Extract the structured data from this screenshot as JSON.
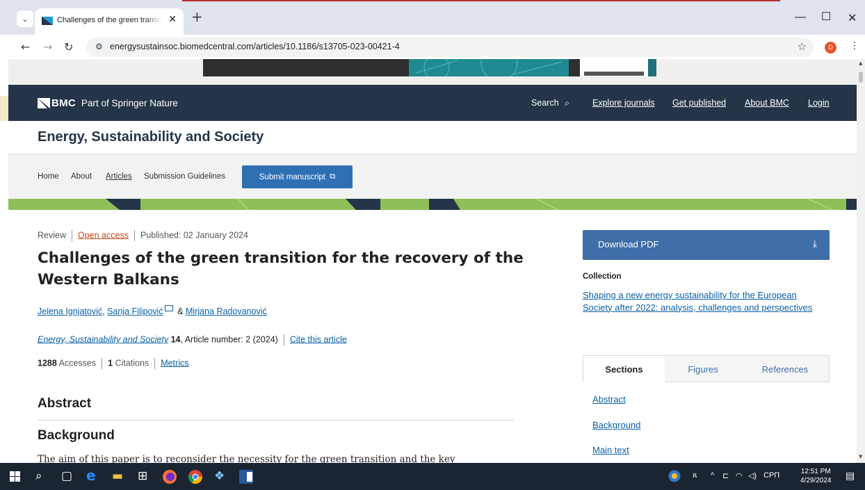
{
  "browser": {
    "tab_title": "Challenges of the green transiti",
    "url": "energysustainsoc.biomedcentral.com/articles/10.1186/s13705-023-00421-4",
    "profile_initial": "D"
  },
  "bmc_header": {
    "logo_text": "BMC",
    "part_of": "Part of Springer Nature",
    "search_label": "Search",
    "links": [
      "Explore journals",
      "Get published",
      "About BMC",
      "Login"
    ]
  },
  "journal": {
    "title": "Energy, Sustainability and Society",
    "nav": [
      "Home",
      "About",
      "Articles",
      "Submission Guidelines"
    ],
    "submit_label": "Submit manuscript"
  },
  "article": {
    "type": "Review",
    "open_access": "Open access",
    "published": "Published: 02 January 2024",
    "title": "Challenges of the green transition for the recovery of the Western Balkans",
    "authors": [
      "Jelena Ignjatović",
      "Sanja Filipović",
      "Mirjana Radovanović"
    ],
    "author_sep_1": ",",
    "author_sep_2": "&",
    "journal_name": "Energy, Sustainability and Society",
    "volume": "14",
    "article_number": ", Article number: 2 (2024)",
    "cite_label": "Cite this article",
    "accesses_count": "1288",
    "accesses_label": "Accesses",
    "citations_count": "1",
    "citations_label": "Citations",
    "metrics_label": "Metrics",
    "abstract_heading": "Abstract",
    "background_heading": "Background",
    "body_first_line": "The aim of this paper is to reconsider the necessity for the green transition and the key"
  },
  "sidebar": {
    "download_label": "Download PDF",
    "collection_label": "Collection",
    "collection_link": "Shaping a new energy sustainability for the European Society after 2022: analysis, challenges and perspectives",
    "tabs": [
      "Sections",
      "Figures",
      "References"
    ],
    "sections": [
      "Abstract",
      "Background",
      "Main text"
    ]
  },
  "taskbar": {
    "tray_lang": "СРП",
    "time": "12:51 PM",
    "date": "4/29/2024"
  }
}
